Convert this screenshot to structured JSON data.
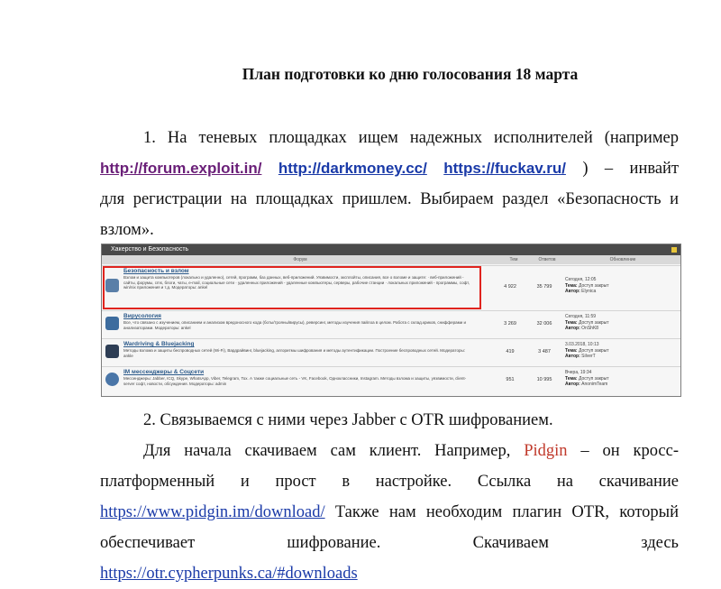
{
  "title": "План подготовки ко дню голосования 18 марта",
  "step1": {
    "line1": "1. На теневых площадках ищем надежных исполнителей (например",
    "link1": "http://forum.exploit.in/",
    "link2": "http://darkmoney.cc/",
    "link3": "https://fuckav.ru/",
    "line2_tail": ")   –   инвайт",
    "line3": "для регистрации на площадках пришлем. Выбираем раздел «Безопасность и",
    "line4": "взлом»."
  },
  "forum": {
    "header": "Хакерство и Безопасность",
    "columns": [
      "Форум",
      "Тем",
      "Ответов",
      "Обновление"
    ],
    "rows": [
      {
        "title": "Безопасность и взлом",
        "desc": "Взлом и защита компьютеров (локально и удаленно), сетей, программ, баз данных, веб-приложений. Уязвимости, эксплойты, описания, все о взломе и защите: · веб-приложений - сайты, форумы, cms, блоги, чаты, e-mail, социальные сети · удаленных приложений - удаленные компьютеры, серверы, рабочие станции · локальных приложений - программы, софт, win/nix приложения и т.д. Модераторы: ankel",
        "topics": "4 922",
        "posts": "35 799",
        "last_time": "Сегодня, 12:05",
        "last_label": "Тема:",
        "last_topic": "Доступ закрыт",
        "last_author_label": "Автор:",
        "last_author": "Elynica"
      },
      {
        "title": "Вирусология",
        "desc": "Все, что связано с изучением, описанием и анализом вредоносного кода (боты/трояны/вирусы), реверсинг, методы изучения пайлоа в целом. Работа с склад.криков, снифферами и анализаторами. Модераторы: ankel",
        "topics": "3 269",
        "posts": "32 006",
        "last_time": "Сегодня, 11:59",
        "last_label": "Тема:",
        "last_topic": "Доступ закрыт",
        "last_author_label": "Автор:",
        "last_author": "OnShK8"
      },
      {
        "title": "Wardriving & Bluejacking",
        "desc": "Методы взлома и защиты беспроводных сетей (Wi-Fi), Вардрайвинг, bluejacking, алгоритмы шифрования и методы аутентификации. Построение беспроводных сетей. Модераторы: ankle",
        "topics": "419",
        "posts": "3 487",
        "last_time": "3.03.2018, 10:13",
        "last_label": "Тема:",
        "last_topic": "Доступ закрыт",
        "last_author_label": "Автор:",
        "last_author": "SilverT"
      },
      {
        "title": "IM мессенджеры & Соцсети",
        "desc": "Мессенджеры: Jabber, ICQ, Skype, WhatsApp, Viber, Telegram, Tox. А также социальные сеть - VK, Facebook, Одноклассники, Instagram. Методы взлома и защиты, уязвимости, client-server софт, новости, обсуждения. Модераторы: admin",
        "topics": "951",
        "posts": "10 995",
        "last_time": "Вчера, 19:34",
        "last_label": "Тема:",
        "last_topic": "Доступ закрыт",
        "last_author_label": "Автор:",
        "last_author": "AnonimTeam"
      }
    ]
  },
  "step2": "2. Связываемся с ними через Jabber с OTR шифрованием.",
  "step2_body": {
    "line1_a": "Для начала скачиваем   сам клиент. Например,",
    "pidgin": "Pidgin",
    "line1_b": "– он кросс-",
    "line2": "платформенный и прост в настройке. Ссылка на скачивание",
    "pidgin_link": "https://www.pidgin.im/download/",
    "line3_tail": "Также нам необходим плагин OTR, который",
    "line4": "обеспечивает шифрование. Скачиваем здесь",
    "otr_link": "https://otr.cypherpunks.ca/#downloads"
  },
  "colors": {
    "highlight_border": "#e0241e",
    "link_purple": "#6a1f78",
    "link_blue": "#1a3aa8",
    "pidgin_red": "#c0392b"
  }
}
